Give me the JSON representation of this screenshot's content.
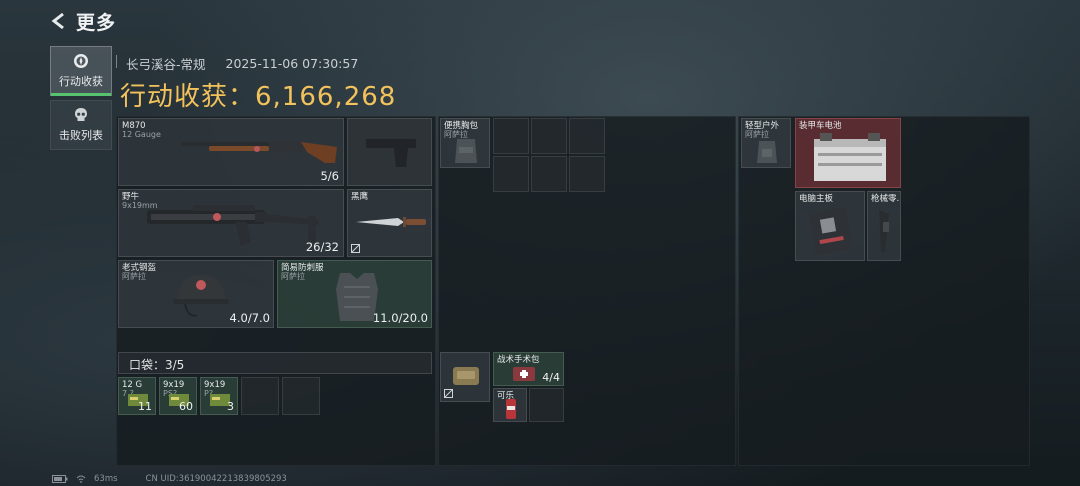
{
  "header": {
    "title": "更多"
  },
  "tabs": [
    {
      "label": "行动收获",
      "active": true,
      "icon": "compass-icon"
    },
    {
      "label": "击败列表",
      "active": false,
      "icon": "skull-icon"
    }
  ],
  "meta": {
    "map": "长弓溪谷-常规",
    "datetime": "2025-11-06 07:30:57"
  },
  "haul": {
    "text": "行动收获：6,166,268"
  },
  "weapons": [
    {
      "name": "M870",
      "sub": "12 Gauge",
      "ammo": "5/6"
    },
    {
      "name": "野牛",
      "sub": "9x19mm",
      "ammo": "26/32"
    }
  ],
  "melee": {
    "name": "黑鹰"
  },
  "armor": [
    {
      "name": "老式钢盔",
      "sub": "阿萨拉",
      "durability": "4.0/7.0"
    },
    {
      "name": "简易防刺服",
      "sub": "阿萨拉",
      "durability": "11.0/20.0"
    }
  ],
  "pockets": {
    "label": "口袋：3/5",
    "items": [
      {
        "name": "12 G",
        "sub": "7.?",
        "qty": "11"
      },
      {
        "name": "9x19",
        "sub": "PS?",
        "qty": "60"
      },
      {
        "name": "9x19",
        "sub": "P?",
        "qty": "3"
      }
    ]
  },
  "chest_rig": {
    "name": "便携胸包",
    "sub": "阿萨拉"
  },
  "pouch_items": [
    {
      "name": "战术手术包",
      "qty": "4/4"
    },
    {
      "name": "可乐"
    }
  ],
  "backpack": {
    "name": "轻型户外",
    "sub": "阿萨拉"
  },
  "loot": [
    {
      "name": "装甲车电池"
    },
    {
      "name": "电脑主板"
    },
    {
      "name": "枪械零..."
    }
  ],
  "footer": {
    "ping": "63ms",
    "uid": "CN UID:36190042213839805293"
  },
  "colors": {
    "accent": "#f2c25c",
    "active_tab": "#56c46e",
    "rare": "#6e3034"
  }
}
